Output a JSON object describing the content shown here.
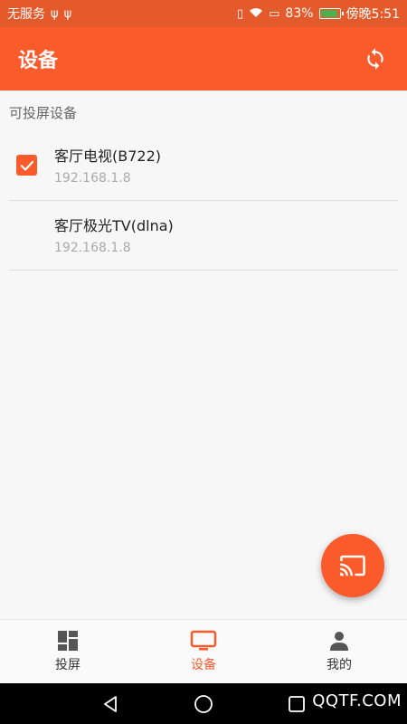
{
  "status_bar": {
    "carrier": "无服务",
    "battery_percent": "83%",
    "time": "傍晚5:51"
  },
  "app_bar": {
    "title": "设备",
    "refresh_icon": "refresh-icon"
  },
  "section_title": "可投屏设备",
  "devices": [
    {
      "name": "客厅电视(B722)",
      "ip": "192.168.1.8",
      "checked": true
    },
    {
      "name": "客厅极光TV(dlna)",
      "ip": "192.168.1.8",
      "checked": false
    }
  ],
  "fab": {
    "icon": "cast-icon"
  },
  "bottom_nav": {
    "items": [
      {
        "label": "投屏",
        "icon": "grid-icon",
        "active": false
      },
      {
        "label": "设备",
        "icon": "tv-icon",
        "active": true
      },
      {
        "label": "我的",
        "icon": "person-icon",
        "active": false
      }
    ]
  },
  "watermark": "QQTF.COM",
  "colors": {
    "accent": "#fb5b2b",
    "status_bar": "#e55a2b"
  }
}
